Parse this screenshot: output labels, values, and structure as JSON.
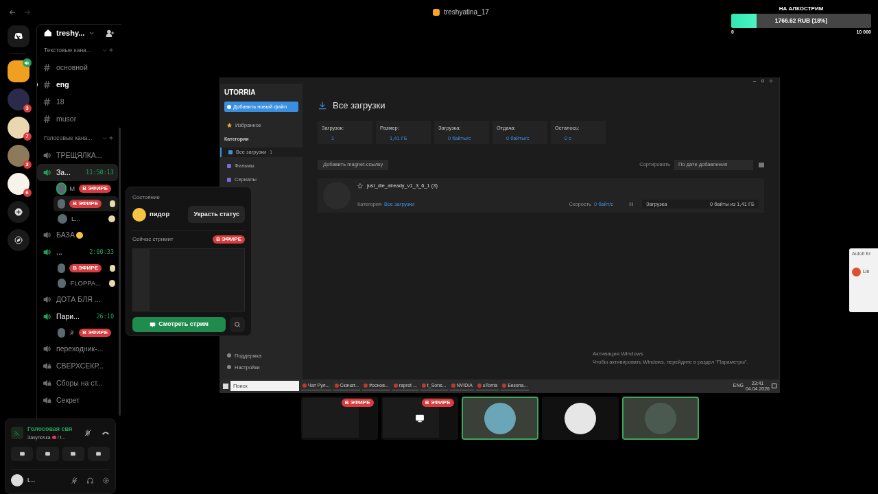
{
  "window": {
    "title": "treshyatina_17"
  },
  "donation": {
    "title": "НА АЛКОСТРИМ",
    "amount": "1766.62 RUB (18%)",
    "level": 0.18,
    "min": "0",
    "max": "10 000"
  },
  "servers": [
    {
      "selected": true,
      "voice_active": true
    },
    {
      "selected": false,
      "voice_active": false,
      "badge": "3"
    },
    {
      "selected": false,
      "voice_active": false,
      "badge": "7"
    },
    {
      "selected": false,
      "voice_active": false,
      "badge": "3"
    },
    {
      "selected": false,
      "voice_active": false,
      "badge": "6"
    }
  ],
  "server_header": {
    "name": "treshy..."
  },
  "channels": [
    {
      "kind": "category",
      "label": "Текстовые кана..."
    },
    {
      "kind": "text",
      "label": "основной",
      "unread": false
    },
    {
      "kind": "text",
      "label": "eng",
      "unread": true
    },
    {
      "kind": "text",
      "label": "18",
      "unread": false
    },
    {
      "kind": "text",
      "label": "musor",
      "unread": false
    },
    {
      "kind": "category",
      "label": "Голосовые кана..."
    },
    {
      "kind": "voice",
      "label": "ТРЕЩЯЛКА...",
      "active": false,
      "selected": false
    },
    {
      "kind": "voice",
      "label": "За...",
      "active": true,
      "selected": true,
      "timer": "11:50:13",
      "children": [
        {
          "name": "M",
          "speaking": true,
          "muted": false,
          "badge": "В ЭФИРЕ",
          "status_emoji": false,
          "hovered": false
        },
        {
          "speaking": false,
          "muted": false,
          "badge": "В ЭФИРЕ",
          "status_emoji": true,
          "hovered": true
        },
        {
          "name": "L...",
          "speaking": false,
          "muted": false,
          "status_emoji": true,
          "hovered": false
        }
      ]
    },
    {
      "kind": "voice",
      "label": "БАЗА",
      "active": false,
      "selected": false,
      "emoji": true
    },
    {
      "kind": "voice",
      "label": "...",
      "active": true,
      "selected": false,
      "timer": "2:00:33",
      "children": [
        {
          "speaking": false,
          "muted": false,
          "badge": "В ЭФИРЕ",
          "status_emoji": true,
          "hovered": false
        },
        {
          "name": "FLOPPA...",
          "speaking": false,
          "muted": false,
          "status_emoji": true,
          "hovered": false
        }
      ]
    },
    {
      "kind": "voice",
      "label": "ДОТА БЛЯ ...",
      "active": false,
      "selected": false
    },
    {
      "kind": "voice",
      "label": "Пари...",
      "active": true,
      "selected": false,
      "timer": "26:10",
      "children": [
        {
          "speaking": false,
          "muted": true,
          "badge": "В ЭФИРЕ",
          "status_emoji": false,
          "hovered": false
        }
      ]
    },
    {
      "kind": "voice",
      "label": "переходник-...",
      "active": false,
      "selected": false
    },
    {
      "kind": "locked",
      "label": "СВЕРХСЕКР..."
    },
    {
      "kind": "locked",
      "label": "Сборы на ст..."
    },
    {
      "kind": "locked",
      "label": "Секрет"
    }
  ],
  "voice_panel": {
    "status": "Голосовая свя",
    "channel": "Зачулочка",
    "channel_suffix": "/ t..."
  },
  "user_panel": {
    "name": "L..."
  },
  "popup": {
    "section": "Состояние",
    "status": "пидор",
    "steal_button": "Украсть статус",
    "streaming_label": "Сейчас стримит",
    "badge": "В ЭФИРЕ",
    "watch_button": "Смотреть стрим"
  },
  "stream": {
    "logo": "UTORRIA",
    "add_file": "Добавить новый файл",
    "favorites": "Избранное",
    "categories": "Категории",
    "nav": [
      {
        "label": "Все загрузки",
        "count": "1",
        "selected": true
      },
      {
        "label": "Фильмы",
        "selected": false
      },
      {
        "label": "Сериалы",
        "selected": false
      }
    ],
    "bottom_nav": [
      "Поддержка",
      "Настройки"
    ],
    "heading": "Все загрузки",
    "stats": [
      {
        "label": "Загрузок:",
        "value": "1"
      },
      {
        "label": "Размер:",
        "value": "1,41 ГБ"
      },
      {
        "label": "Загрузка:",
        "value": "0 байты/с"
      },
      {
        "label": "Отдача:",
        "value": "0 байты/с"
      },
      {
        "label": "Осталось:",
        "value": "0 с"
      }
    ],
    "magnet": "Добавить magnet-ссылку",
    "sort_label": "Сортировать",
    "sort_value": "По дате добавления",
    "item": {
      "name": "just_die_already_v1_3_6_1 (3)",
      "category_label": "Категория",
      "category": "Все загрузки",
      "speed_label": "Скорость",
      "speed": "0 байт/с",
      "state": "Загрузка",
      "progress": "0 байты из 1,41 ГБ"
    },
    "activation": {
      "title": "Активация Windows",
      "text": "Чтобы активировать Windows, перейдите в раздел \"Параметры\"."
    },
    "taskbar": {
      "search": "Поиск",
      "apps": [
        "Чат Рул...",
        "Скачат...",
        "#основ...",
        "raprot ...",
        "t_Sons...",
        "NVIDIA",
        "uTorria",
        "Безопа..."
      ],
      "lang": "ENG",
      "time": "23:41",
      "date": "04.04.2026"
    }
  },
  "tiles": [
    {
      "kind": "screen",
      "badge": "В ЭФИРЕ",
      "speaking": false
    },
    {
      "kind": "screen",
      "badge": "В ЭФИРЕ",
      "speaking": false,
      "monitor": true
    },
    {
      "kind": "avatar",
      "speaking": true
    },
    {
      "kind": "avatar",
      "speaking": false
    },
    {
      "kind": "avatar",
      "speaking": true
    }
  ],
  "notification": {
    "title": "AutoIt Er",
    "text": "Lin"
  }
}
